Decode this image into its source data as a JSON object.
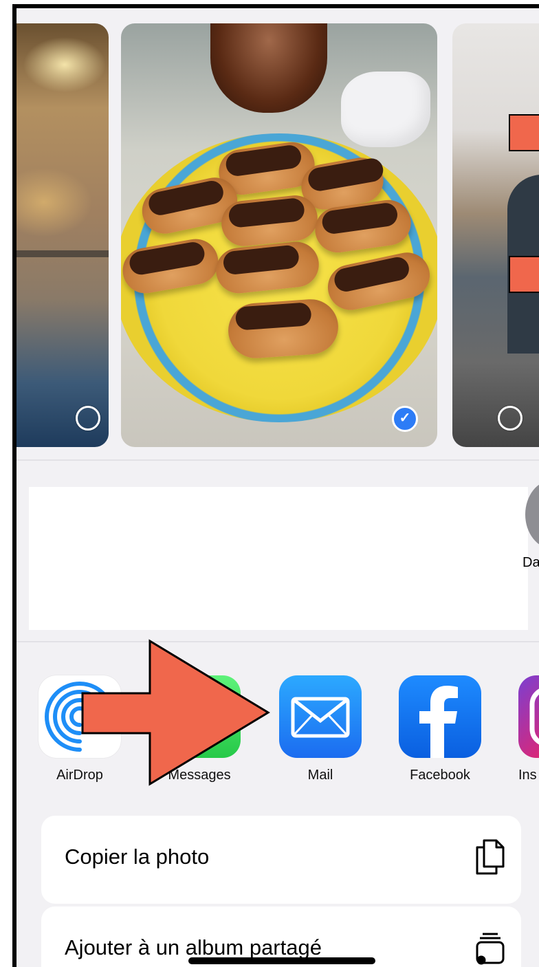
{
  "photos": [
    {
      "name": "oven-photo",
      "selected": false
    },
    {
      "name": "eclairs-photo",
      "selected": true
    },
    {
      "name": "person-photo",
      "selected": false
    }
  ],
  "contacts": {
    "partial_name": "Da"
  },
  "apps": [
    {
      "label": "AirDrop",
      "icon": "airdrop-icon"
    },
    {
      "label": "Messages",
      "icon": "messages-icon"
    },
    {
      "label": "Mail",
      "icon": "mail-icon"
    },
    {
      "label": "Facebook",
      "icon": "facebook-icon"
    },
    {
      "label": "Ins",
      "icon": "instagram-icon"
    }
  ],
  "actions": [
    {
      "label": "Copier la photo",
      "icon": "copy-icon"
    },
    {
      "label": "Ajouter à un album partagé",
      "icon": "shared-album-icon"
    }
  ],
  "colors": {
    "sheet_background": "#f2f1f4",
    "selection_blue": "#2d7cf6",
    "annotation_red": "#f0674c"
  }
}
